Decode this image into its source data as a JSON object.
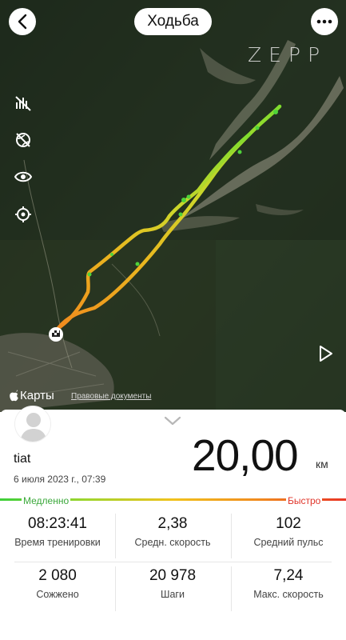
{
  "header": {
    "title": "Ходьба",
    "watermark": "ZEPP"
  },
  "map": {
    "attribution": "Карты",
    "legal_link": "Правовые документы",
    "tools": [
      "satellite-off-icon",
      "globe-off-icon",
      "eye-icon",
      "locate-icon"
    ]
  },
  "workout": {
    "user": "tiat",
    "date": "6 июля 2023 г., 07:39",
    "distance": "20,00",
    "unit": "км",
    "pace_slow": "Медленно",
    "pace_fast": "Быстро"
  },
  "stats": [
    {
      "value": "08:23:41",
      "label": "Время тренировки"
    },
    {
      "value": "2,38",
      "label": "Средн. скорость"
    },
    {
      "value": "102",
      "label": "Средний пульс"
    },
    {
      "value": "2 080",
      "label": "Сожжено"
    },
    {
      "value": "20 978",
      "label": "Шаги"
    },
    {
      "value": "7,24",
      "label": "Макс. скорость"
    }
  ],
  "colors": {
    "slow": "#3ecf3a",
    "mid": "#f1c21c",
    "fast": "#e93525"
  }
}
